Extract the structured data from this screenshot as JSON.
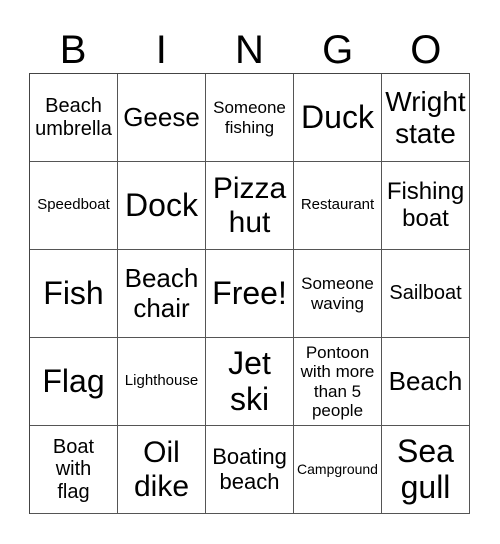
{
  "header": [
    "B",
    "I",
    "N",
    "G",
    "O"
  ],
  "rows": [
    [
      "Beach umbrella",
      "Geese",
      "Someone fishing",
      "Duck",
      "Wright state"
    ],
    [
      "Speedboat",
      "Dock",
      "Pizza hut",
      "Restaurant",
      "Fishing boat"
    ],
    [
      "Fish",
      "Beach chair",
      "Free!",
      "Someone waving",
      "Sailboat"
    ],
    [
      "Flag",
      "Lighthouse",
      "Jet ski",
      "Pontoon with more than 5 people",
      "Beach"
    ],
    [
      "Boat with flag",
      "Oil dike",
      "Boating beach",
      "Campground",
      "Sea gull"
    ]
  ]
}
